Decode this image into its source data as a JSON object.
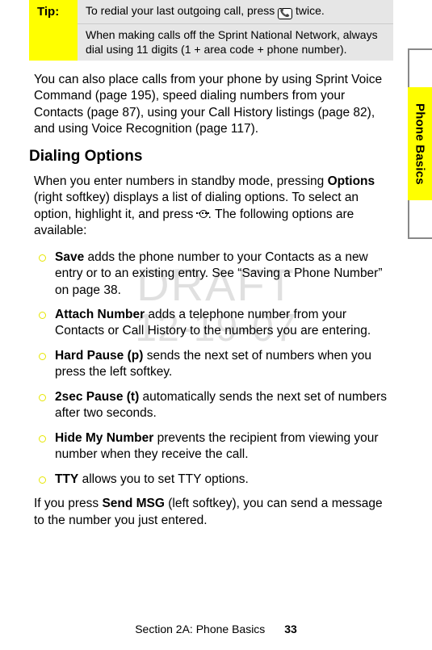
{
  "side_tab": "Phone Basics",
  "tip": {
    "label": "Tip:",
    "row1_pre": "To redial your last outgoing call, press ",
    "row1_post": " twice.",
    "row2": "When making calls off the Sprint National Network, always dial using 11 digits (1 + area code + phone number)."
  },
  "intro_after_tip": "You can also place calls from your phone by using Sprint Voice Command (page 195), speed dialing numbers from your Contacts (page 87), using your Call History listings (page 82), and using Voice Recognition (page 117).",
  "heading": "Dialing Options",
  "intro_options_pre": "When you enter numbers in standby mode, pressing ",
  "intro_options_bold1": "Options",
  "intro_options_mid": " (right softkey) displays a list of dialing options. To select an option, highlight it, and press ",
  "intro_options_post": ". The following options are available:",
  "options": [
    {
      "name": "Save",
      "text": " adds the phone number to your Contacts as a new entry or to an existing entry. See “Saving a Phone Number” on page 38."
    },
    {
      "name": "Attach Number",
      "text": " adds a telephone number from your Contacts or Call History to the numbers you are entering."
    },
    {
      "name": "Hard Pause (p)",
      "text": " sends the next set of numbers when you press the left softkey."
    },
    {
      "name": "2sec Pause (t)",
      "text": " automatically sends the next set of numbers after two seconds."
    },
    {
      "name": "Hide My Number",
      "text": " prevents the recipient from viewing your number when they receive the call."
    },
    {
      "name": "TTY",
      "text": " allows you to set TTY options."
    }
  ],
  "closing_pre": "If you press ",
  "closing_bold": "Send MSG",
  "closing_post": " (left softkey), you can send a message to the number you just entered.",
  "watermark": {
    "line1": "DRAFT",
    "line2": "12-19-07"
  },
  "footer": {
    "section": "Section 2A: Phone Basics",
    "page": "33"
  }
}
